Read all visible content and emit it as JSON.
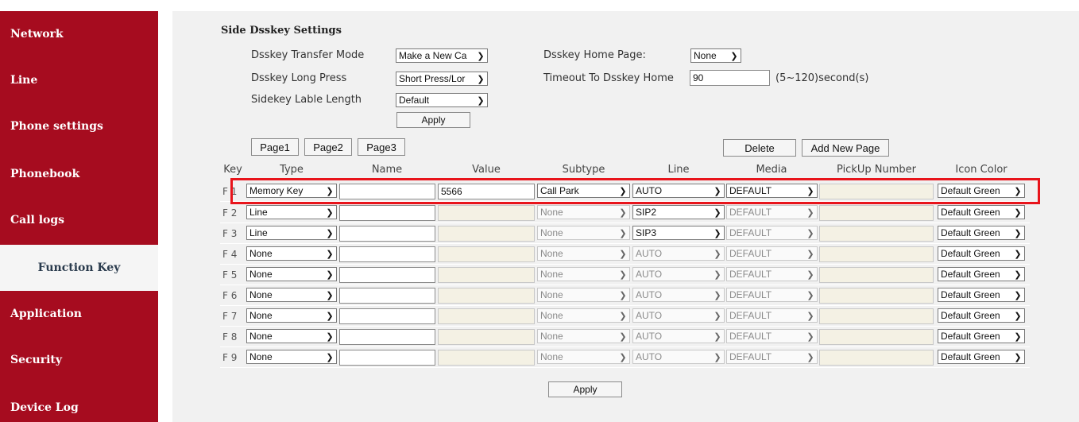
{
  "sidebar": {
    "items": [
      {
        "label": "Network"
      },
      {
        "label": "Line"
      },
      {
        "label": "Phone settings"
      },
      {
        "label": "Phonebook"
      },
      {
        "label": "Call logs"
      },
      {
        "label": "Function Key"
      },
      {
        "label": "Application"
      },
      {
        "label": "Security"
      },
      {
        "label": "Device Log"
      }
    ],
    "active": "Function Key"
  },
  "settings": {
    "title": "Side Dsskey Settings",
    "transfer_mode_label": "Dsskey Transfer Mode",
    "transfer_mode_value": "Make a New Ca",
    "long_press_label": "Dsskey Long Press",
    "long_press_value": "Short Press/Lor",
    "lable_length_label": "Sidekey Lable Length",
    "lable_length_value": "Default",
    "home_page_label": "Dsskey Home Page:",
    "home_page_value": "None",
    "timeout_label": "Timeout To Dsskey Home",
    "timeout_value": "90",
    "timeout_hint": "(5~120)second(s)",
    "apply_label": "Apply"
  },
  "pages": {
    "page1": "Page1",
    "page2": "Page2",
    "page3": "Page3",
    "delete": "Delete",
    "add_new": "Add New Page"
  },
  "table": {
    "headers": {
      "key": "Key",
      "type": "Type",
      "name": "Name",
      "value": "Value",
      "subtype": "Subtype",
      "line": "Line",
      "media": "Media",
      "pickup": "PickUp Number",
      "icon_color": "Icon Color"
    },
    "rows": [
      {
        "key": "F 1",
        "type": "Memory Key",
        "name": "",
        "value": "5566",
        "subtype": "Call Park",
        "line": "AUTO",
        "media": "DEFAULT",
        "pickup": "",
        "icon_color": "Default Green"
      },
      {
        "key": "F 2",
        "type": "Line",
        "name": "",
        "value": "",
        "subtype": "None",
        "line": "SIP2",
        "media": "DEFAULT",
        "pickup": "",
        "icon_color": "Default Green"
      },
      {
        "key": "F 3",
        "type": "Line",
        "name": "",
        "value": "",
        "subtype": "None",
        "line": "SIP3",
        "media": "DEFAULT",
        "pickup": "",
        "icon_color": "Default Green"
      },
      {
        "key": "F 4",
        "type": "None",
        "name": "",
        "value": "",
        "subtype": "None",
        "line": "AUTO",
        "media": "DEFAULT",
        "pickup": "",
        "icon_color": "Default Green"
      },
      {
        "key": "F 5",
        "type": "None",
        "name": "",
        "value": "",
        "subtype": "None",
        "line": "AUTO",
        "media": "DEFAULT",
        "pickup": "",
        "icon_color": "Default Green"
      },
      {
        "key": "F 6",
        "type": "None",
        "name": "",
        "value": "",
        "subtype": "None",
        "line": "AUTO",
        "media": "DEFAULT",
        "pickup": "",
        "icon_color": "Default Green"
      },
      {
        "key": "F 7",
        "type": "None",
        "name": "",
        "value": "",
        "subtype": "None",
        "line": "AUTO",
        "media": "DEFAULT",
        "pickup": "",
        "icon_color": "Default Green"
      },
      {
        "key": "F 8",
        "type": "None",
        "name": "",
        "value": "",
        "subtype": "None",
        "line": "AUTO",
        "media": "DEFAULT",
        "pickup": "",
        "icon_color": "Default Green"
      },
      {
        "key": "F 9",
        "type": "None",
        "name": "",
        "value": "",
        "subtype": "None",
        "line": "AUTO",
        "media": "DEFAULT",
        "pickup": "",
        "icon_color": "Default Green"
      }
    ]
  },
  "bottom_apply_label": "Apply",
  "colors": {
    "sidebar_bg": "#a60c1f",
    "highlight": "#e8141b",
    "panel_bg": "#f1f1f1"
  }
}
